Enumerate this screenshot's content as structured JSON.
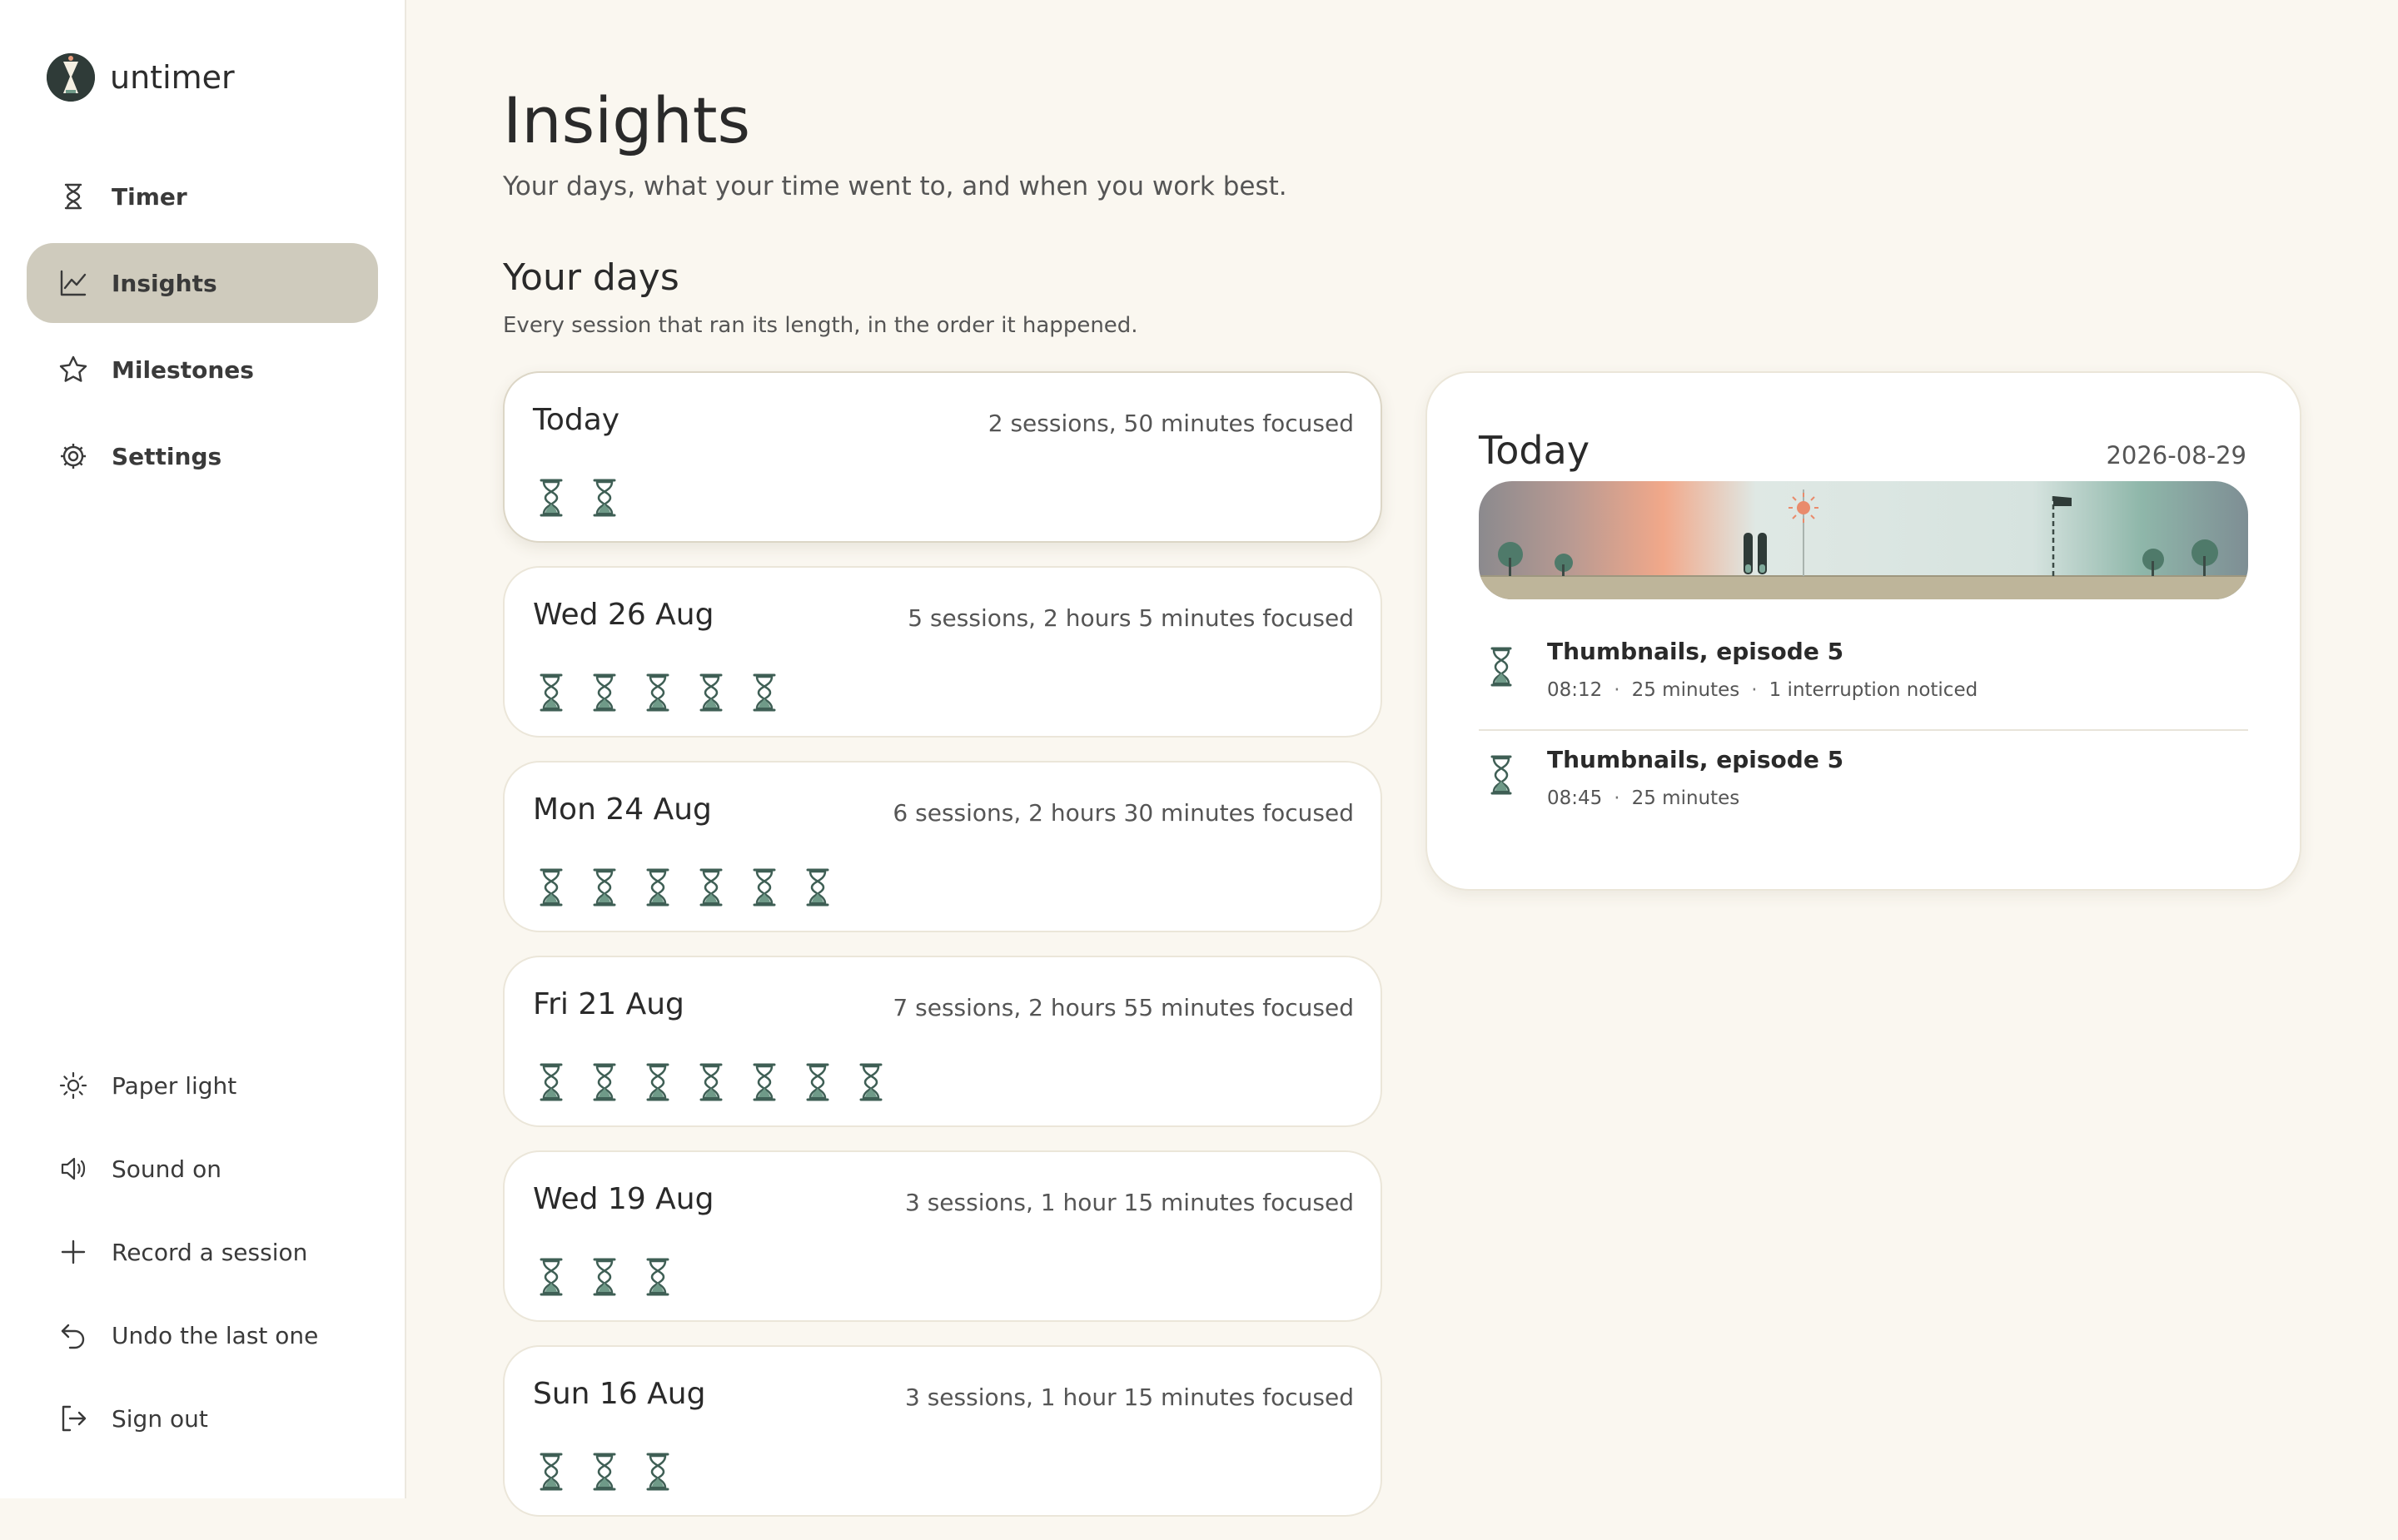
{
  "colors": {
    "accent": "#cfcbbd",
    "hourglass": "#5e8a78",
    "background": "#faf7f0"
  },
  "sidebar": {
    "app_name": "untimer",
    "nav": [
      {
        "label": "Timer",
        "icon": "hourglass-icon"
      },
      {
        "label": "Insights",
        "icon": "chart-line-icon",
        "active": true
      },
      {
        "label": "Milestones",
        "icon": "star-icon"
      },
      {
        "label": "Settings",
        "icon": "gear-icon"
      }
    ],
    "utilities": [
      {
        "label": "Paper light",
        "icon": "sun-icon"
      },
      {
        "label": "Sound on",
        "icon": "speaker-icon"
      },
      {
        "label": "Record a session",
        "icon": "plus-icon"
      },
      {
        "label": "Undo the last one",
        "icon": "undo-icon"
      },
      {
        "label": "Sign out",
        "icon": "sign-out-icon"
      }
    ]
  },
  "main": {
    "title": "Insights",
    "subtitle": "Your days, what your time went to, and when you work best.",
    "section_title": "Your days",
    "section_subtitle": "Every session that ran its length, in the order it happened.",
    "days": [
      {
        "name": "Today",
        "summary": "2 sessions, 50 minutes focused",
        "sessions": 2
      },
      {
        "name": "Wed 26 Aug",
        "summary": "5 sessions, 2 hours 5 minutes focused",
        "sessions": 5
      },
      {
        "name": "Mon 24 Aug",
        "summary": "6 sessions, 2 hours 30 minutes focused",
        "sessions": 6
      },
      {
        "name": "Fri 21 Aug",
        "summary": "7 sessions, 2 hours 55 minutes focused",
        "sessions": 7
      },
      {
        "name": "Wed 19 Aug",
        "summary": "3 sessions, 1 hour 15 minutes focused",
        "sessions": 3
      },
      {
        "name": "Sun 16 Aug",
        "summary": "3 sessions, 1 hour 15 minutes focused",
        "sessions": 3
      }
    ]
  },
  "detail": {
    "title": "Today",
    "date": "2026-08-29",
    "sessions": [
      {
        "title": "Thumbnails, episode 5",
        "time": "08:12",
        "duration": "25 minutes",
        "note": "1 interruption noticed"
      },
      {
        "title": "Thumbnails, episode 5",
        "time": "08:45",
        "duration": "25 minutes",
        "note": ""
      }
    ]
  }
}
